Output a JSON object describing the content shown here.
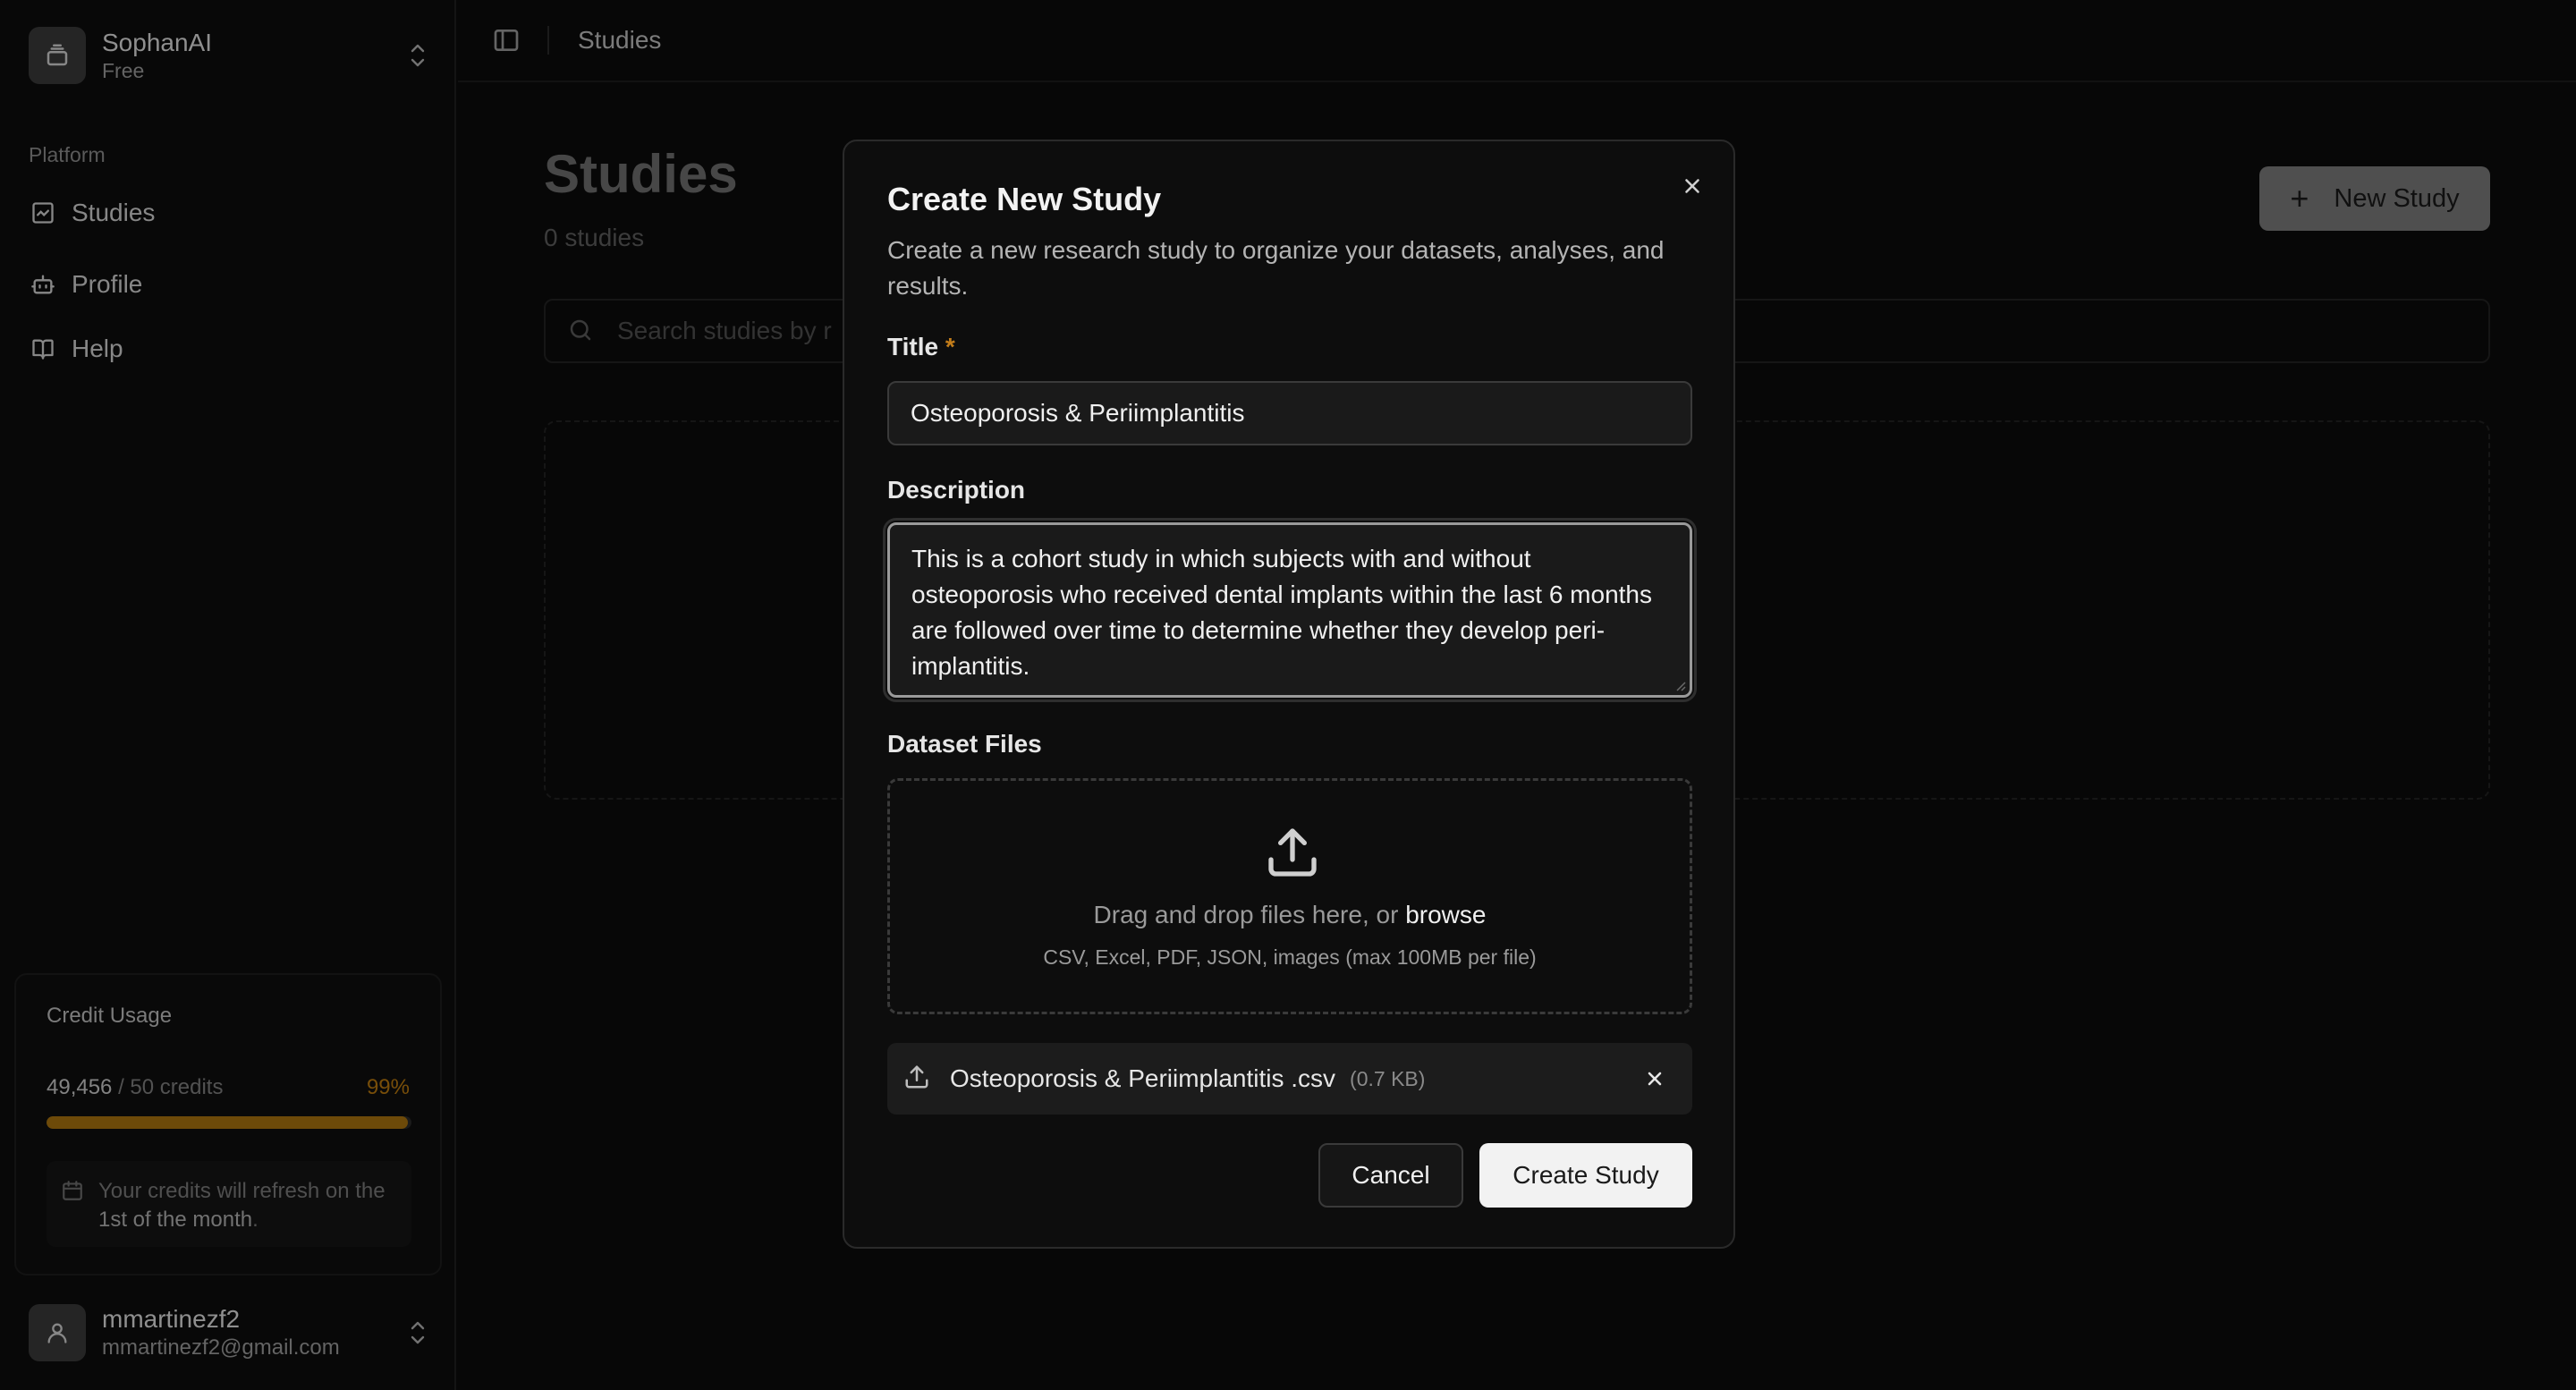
{
  "workspace": {
    "name": "SophanAI",
    "plan": "Free",
    "icon": "workspace-icon"
  },
  "sidebar": {
    "section_label": "Platform",
    "items": [
      {
        "label": "Studies",
        "icon": "chart-icon"
      },
      {
        "label": "Profile",
        "icon": "bot-icon"
      },
      {
        "label": "Help",
        "icon": "book-icon"
      }
    ]
  },
  "credits": {
    "title": "Credit Usage",
    "used": "49,456",
    "total_text": "/ 50 credits",
    "percent_text": "99%",
    "percent": 99,
    "refresh_prefix": "Your credits will refresh on the ",
    "refresh_highlight": "1st of the month",
    "refresh_suffix": ".",
    "bar_color": "#a8720e"
  },
  "user": {
    "name": "mmartinezf2",
    "email": "mmartinezf2@gmail.com"
  },
  "topbar": {
    "breadcrumb": "Studies"
  },
  "page": {
    "title": "Studies",
    "count": "0 studies",
    "new_button": "New Study",
    "search_placeholder": "Search studies by r"
  },
  "modal": {
    "title": "Create New Study",
    "description": "Create a new research study to organize your datasets, analyses, and results.",
    "title_label": "Title",
    "required_mark": "*",
    "title_value": "Osteoporosis & Periimplantitis",
    "description_label": "Description",
    "description_value": "This is a cohort study in which subjects with and without osteoporosis who received dental implants within the last 6 months are followed over time to determine whether they develop peri-implantitis.",
    "dataset_label": "Dataset Files",
    "drop_text": "Drag and drop files here, or ",
    "drop_browse": "browse",
    "drop_hint": "CSV, Excel, PDF, JSON, images (max 100MB per file)",
    "file_name": "Osteoporosis & Periimplantitis .csv",
    "file_size": "(0.7 KB)",
    "cancel": "Cancel",
    "create": "Create Study"
  }
}
